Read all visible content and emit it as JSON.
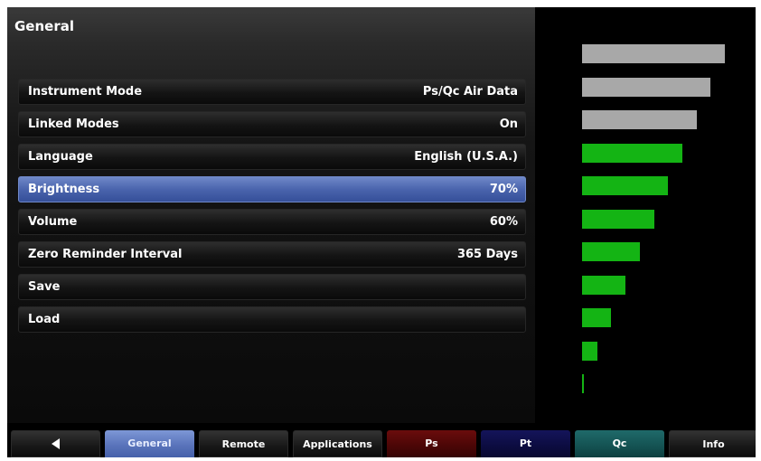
{
  "panel": {
    "title": "General"
  },
  "settings": [
    {
      "label": "Instrument Mode",
      "value": "Ps/Qc Air Data",
      "selected": false
    },
    {
      "label": "Linked Modes",
      "value": "On",
      "selected": false
    },
    {
      "label": "Language",
      "value": "English (U.S.A.)",
      "selected": false
    },
    {
      "label": "Brightness",
      "value": "70%",
      "selected": true
    },
    {
      "label": "Volume",
      "value": "60%",
      "selected": false
    },
    {
      "label": "Zero Reminder Interval",
      "value": "365 Days",
      "selected": false
    },
    {
      "label": "Save",
      "value": "",
      "selected": false
    },
    {
      "label": "Load",
      "value": "",
      "selected": false
    }
  ],
  "brightness_scale": {
    "level_percent": 70,
    "segments": 11,
    "active_segments": 8,
    "active_color": "#14b414",
    "inactive_color": "#a8a8a8"
  },
  "tabs": [
    {
      "id": "back",
      "label": "",
      "icon": "back-arrow-icon"
    },
    {
      "id": "general",
      "label": "General",
      "active": true
    },
    {
      "id": "remote",
      "label": "Remote"
    },
    {
      "id": "applications",
      "label": "Applications"
    },
    {
      "id": "ps",
      "label": "Ps",
      "color": "#4a0606"
    },
    {
      "id": "pt",
      "label": "Pt",
      "color": "#0c0c40"
    },
    {
      "id": "qc",
      "label": "Qc",
      "color": "#145252"
    },
    {
      "id": "info",
      "label": "Info"
    }
  ]
}
